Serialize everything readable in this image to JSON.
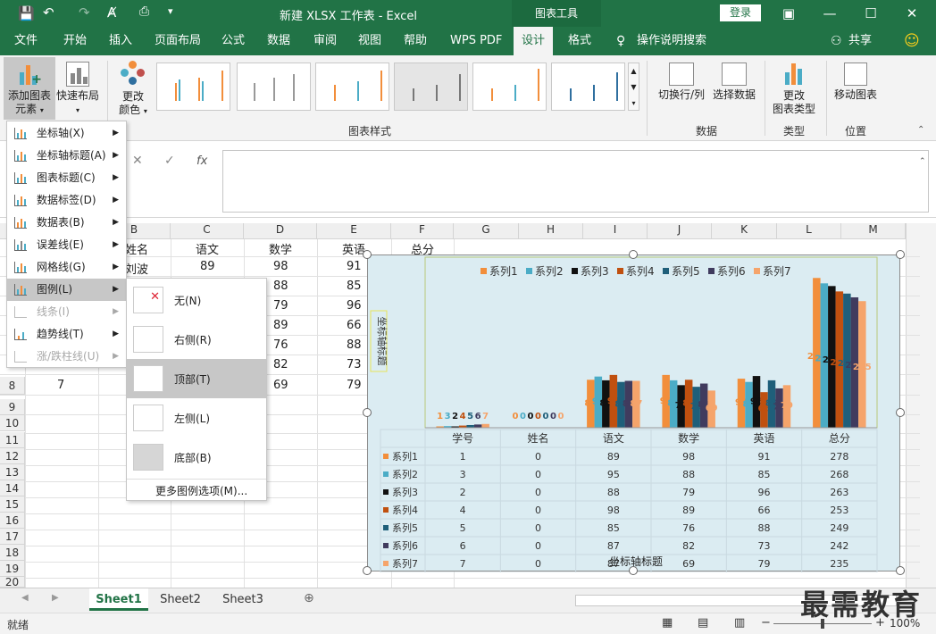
{
  "window": {
    "title": "新建 XLSX 工作表 - Excel",
    "context_tab": "图表工具",
    "login": "登录"
  },
  "tabs": [
    "文件",
    "开始",
    "插入",
    "页面布局",
    "公式",
    "数据",
    "审阅",
    "视图",
    "帮助",
    "WPS PDF",
    "设计",
    "格式"
  ],
  "tell_me": "操作说明搜索",
  "share": "共享",
  "ribbon": {
    "add_element": [
      "添加图表",
      "元素"
    ],
    "quick_layout": "快速布局",
    "change_colors": [
      "更改",
      "颜色"
    ],
    "chart_styles_label": "图表样式",
    "switch_row_col": "切换行/列",
    "select_data": "选择数据",
    "data_label": "数据",
    "change_type": [
      "更改",
      "图表类型"
    ],
    "type_label": "类型",
    "move_chart": "移动图表",
    "location_label": "位置"
  },
  "formula_bar": {
    "fx": "fx"
  },
  "columns": [
    "B",
    "C",
    "D",
    "E",
    "F",
    "G",
    "H",
    "I",
    "J",
    "K",
    "L",
    "M"
  ],
  "rows": [
    "8",
    "9",
    "10",
    "11",
    "12",
    "13",
    "14",
    "15",
    "16",
    "17",
    "18",
    "19",
    "20"
  ],
  "table": {
    "headers": [
      "姓名",
      "语文",
      "数学",
      "英语",
      "总分"
    ],
    "visible_rows": [
      [
        "刘波",
        "89",
        "98",
        "91"
      ],
      [
        "",
        "",
        "88",
        "85"
      ],
      [
        "",
        "",
        "79",
        "96"
      ],
      [
        "",
        "",
        "89",
        "66"
      ],
      [
        "",
        "",
        "76",
        "88"
      ],
      [
        "",
        "",
        "82",
        "73"
      ],
      [
        "7",
        "",
        "69",
        "79"
      ]
    ]
  },
  "chart_menu": [
    {
      "label": "坐标轴(X)",
      "enabled": true
    },
    {
      "label": "坐标轴标题(A)",
      "enabled": true
    },
    {
      "label": "图表标题(C)",
      "enabled": true
    },
    {
      "label": "数据标签(D)",
      "enabled": true
    },
    {
      "label": "数据表(B)",
      "enabled": true
    },
    {
      "label": "误差线(E)",
      "enabled": true
    },
    {
      "label": "网格线(G)",
      "enabled": true
    },
    {
      "label": "图例(L)",
      "enabled": true
    },
    {
      "label": "线条(I)",
      "enabled": false
    },
    {
      "label": "趋势线(T)",
      "enabled": true
    },
    {
      "label": "涨/跌柱线(U)",
      "enabled": false
    }
  ],
  "legend_menu": [
    "无(N)",
    "右侧(R)",
    "顶部(T)",
    "左侧(L)",
    "底部(B)"
  ],
  "legend_more": "更多图例选项(M)...",
  "chart_data": {
    "type": "bar",
    "categories": [
      "学号",
      "姓名",
      "语文",
      "数学",
      "英语",
      "总分"
    ],
    "series": [
      {
        "name": "系列1",
        "color": "#f28e3b",
        "values": [
          1,
          0,
          89,
          98,
          91,
          278
        ]
      },
      {
        "name": "系列2",
        "color": "#4bacc6",
        "values": [
          3,
          0,
          95,
          88,
          85,
          268
        ]
      },
      {
        "name": "系列3",
        "color": "#111111",
        "values": [
          2,
          0,
          88,
          79,
          96,
          263
        ]
      },
      {
        "name": "系列4",
        "color": "#c0500f",
        "values": [
          4,
          0,
          98,
          89,
          66,
          253
        ]
      },
      {
        "name": "系列5",
        "color": "#1f5f7a",
        "values": [
          5,
          0,
          85,
          76,
          88,
          249
        ]
      },
      {
        "name": "系列6",
        "color": "#403b5e",
        "values": [
          6,
          0,
          87,
          82,
          73,
          242
        ]
      },
      {
        "name": "系列7",
        "color": "#f5a46b",
        "values": [
          7,
          0,
          87,
          69,
          79,
          235
        ]
      }
    ],
    "ylim": [
      0,
      300
    ],
    "y_axis_title": "坐标轴标题",
    "x_axis_title": "坐标轴标题",
    "legend_position": "top"
  },
  "sheets": [
    "Sheet1",
    "Sheet2",
    "Sheet3"
  ],
  "status": {
    "ready": "就绪",
    "zoom": "100%"
  },
  "watermark": "最需教育"
}
